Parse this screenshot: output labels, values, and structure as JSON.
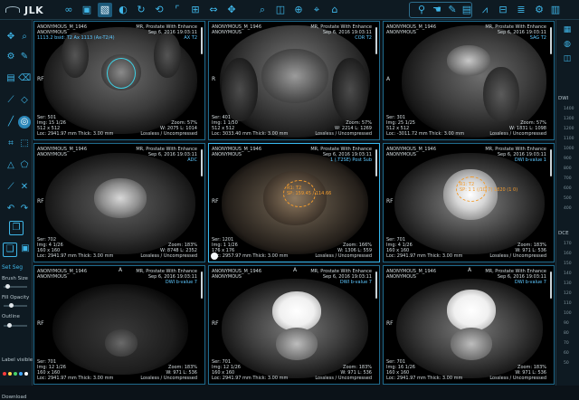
{
  "app": {
    "logo_text": "JLK"
  },
  "toolbar": {
    "tools": [
      {
        "name": "link-icon",
        "glyph": "∞"
      },
      {
        "name": "layout-icon",
        "glyph": "▣"
      },
      {
        "name": "image-icon",
        "glyph": "▧"
      },
      {
        "name": "window-level-icon",
        "glyph": "◐"
      },
      {
        "name": "rotate-icon",
        "glyph": "↻"
      },
      {
        "name": "reset-icon",
        "glyph": "⟲"
      },
      {
        "name": "fit-icon",
        "glyph": "⌜"
      },
      {
        "name": "split-icon",
        "glyph": "⊞"
      },
      {
        "name": "flip-icon",
        "glyph": "⇔"
      },
      {
        "name": "move-icon",
        "glyph": "✥"
      },
      {
        "name": "zoom-icon",
        "glyph": "⌕"
      },
      {
        "name": "measure-icon",
        "glyph": "◫"
      },
      {
        "name": "target-icon",
        "glyph": "⊕"
      },
      {
        "name": "crosshair-icon",
        "glyph": "⌖"
      },
      {
        "name": "tag-icon",
        "glyph": "⌂"
      },
      {
        "name": "pin-icon",
        "glyph": "⚲"
      },
      {
        "name": "hand-icon",
        "glyph": "☚"
      },
      {
        "name": "draw-icon",
        "glyph": "✎"
      },
      {
        "name": "note-icon",
        "glyph": "▤"
      },
      {
        "name": "chart-icon",
        "glyph": "⩘"
      },
      {
        "name": "grid-icon",
        "glyph": "⊟"
      },
      {
        "name": "list-icon",
        "glyph": "≣"
      },
      {
        "name": "settings-icon",
        "glyph": "⚙"
      },
      {
        "name": "report-icon",
        "glyph": "▥"
      }
    ]
  },
  "left_panel": {
    "set_seg": "Set Seg",
    "brush_size": "Brush Size",
    "fill_opacity": "Fill Opacity",
    "outline": "Outline",
    "label_visible": "Label visible",
    "download": "Download",
    "label_colors": [
      "#ff3b3b",
      "#ffd54a",
      "#49d36a",
      "#3fa7ff",
      "#ffffff"
    ],
    "fill_opacity_level": 0.3,
    "outline_level": 0.2,
    "brush_level": 0.1
  },
  "right_panel": {
    "dwi": "DWI",
    "dwi_values": [
      "1400",
      "1300",
      "1200",
      "1100",
      "1000",
      "900",
      "800",
      "700",
      "600",
      "500",
      "400"
    ],
    "dce": "DCE",
    "dce_values": [
      "170",
      "160",
      "150",
      "140",
      "130",
      "120",
      "110",
      "100",
      "90",
      "80",
      "70",
      "60",
      "50"
    ]
  },
  "viewports": [
    {
      "id": "ax-t2",
      "tl": [
        "ANONYMOUS_M_1946",
        "ANONYMOUS"
      ],
      "tl_accent": "1113.2  bsid: T2 Ax 1113 (Ax-T2/4)",
      "tr": [
        "MR, Prostate With Enhance",
        "Sep 6, 2016 19:03:11"
      ],
      "tr_accent": "AX T2",
      "bl": [
        "Ser: 501",
        "Img: 15 1/26",
        "512 x 512",
        "Loc: 2941.97 mm Thick: 3.00 mm"
      ],
      "br": [
        "Zoom: 57%",
        "W: 2075 L: 1014",
        "Lossless / Uncompressed"
      ],
      "orient_left": "RF"
    },
    {
      "id": "cor-t2",
      "tl": [
        "ANONYMOUS_M_1946",
        "ANONYMOUS"
      ],
      "tl_accent": "",
      "tr": [
        "MR, Prostate With Enhance",
        "Sep 6, 2016 19:03:11"
      ],
      "tr_accent": "COR T2",
      "bl": [
        "Ser: 401",
        "Img: 1 1/50",
        "512 x 512",
        "Loc: 3033.40 mm Thick: 3.00 mm"
      ],
      "br": [
        "Zoom: 57%",
        "W: 2214 L: 1269",
        "Lossless / Uncompressed"
      ],
      "orient_left": "R"
    },
    {
      "id": "sag-t2",
      "tl": [
        "ANONYMOUS_M_1946",
        "ANONYMOUS"
      ],
      "tl_accent": "",
      "tr": [
        "MR, Prostate With Enhance",
        "Sep 6, 2016 19:03:11"
      ],
      "tr_accent": "SAG T2",
      "bl": [
        "Ser: 301",
        "Img: 25 1/25",
        "512 x 512",
        "Loc: -3011.72 mm Thick: 3.00 mm"
      ],
      "br": [
        "Zoom: 57%",
        "W: 1831 L: 1098",
        "Lossless / Uncompressed"
      ],
      "orient_left": "A"
    },
    {
      "id": "adc",
      "tl": [
        "ANONYMOUS_M_1946",
        "ANONYMOUS"
      ],
      "tl_accent": "",
      "tr": [
        "MR, Prostate With Enhance",
        "Sep 6, 2016 19:03:11"
      ],
      "tr_accent": "ADC",
      "bl": [
        "Ser: 702",
        "Img: 4 1/26",
        "160 x 160",
        "Loc: 2941.97 mm Thick: 3.00 mm"
      ],
      "br": [
        "Zoom: 183%",
        "W: 8748 L: 2352",
        "Lossless / Uncompressed"
      ],
      "orient_left": "RF"
    },
    {
      "id": "t2-post",
      "tl": [
        "ANONYMOUS_M_1946",
        "ANONYMOUS"
      ],
      "tl_accent": "",
      "tr": [
        "MR, Prostate With Enhance",
        "Sep 6, 2016 19:03:11"
      ],
      "tr_accent": "1 (.T2SE) Post Sub",
      "bl": [
        "Ser: 1201",
        "Img: 1 1/26",
        "176 x 176",
        "Loc: 2957.97 mm Thick: 3.00 mm"
      ],
      "br": [
        "Zoom: 166%",
        "W: 1306 L: 559",
        "Lossless / Uncompressed"
      ],
      "orient_left": "RF",
      "roi": [
        "R1: T2",
        "SP: 159.45 / 114.66"
      ]
    },
    {
      "id": "dwi-1",
      "tl": [
        "ANONYMOUS_M_1946",
        "ANONYMOUS"
      ],
      "tl_accent": "",
      "tr": [
        "MR, Prostate With Enhance",
        "Sep 6, 2016 19:03:11"
      ],
      "tr_accent": "DWI b-value 1",
      "bl": [
        "Ser: 701",
        "Img: 4 1/26",
        "160 x 160",
        "Loc: 2941.97 mm Thick: 3.00 mm"
      ],
      "br": [
        "Zoom: 183%",
        "W: 971 L: 536",
        "Lossless / Uncompressed"
      ],
      "orient_left": "RF",
      "roi": [
        "R1: T2",
        "SP: 1 1 (/1D 7) 1820 (1 0)"
      ]
    },
    {
      "id": "dwi-7a",
      "tl": [
        "ANONYMOUS_M_1946",
        "ANONYMOUS"
      ],
      "tl_accent": "",
      "tr": [
        "MR, Prostate With Enhance",
        "Sep 6, 2016 19:03:11"
      ],
      "tr_accent": "DWI b-value 7",
      "bl": [
        "Ser: 701",
        "Img: 12 1/26",
        "160 x 160",
        "Loc: 2941.97 mm Thick: 3.00 mm"
      ],
      "br": [
        "Zoom: 183%",
        "W: 971 L: 536",
        "Lossless / Uncompressed"
      ],
      "orient_left": "RF",
      "orient_top": "A"
    },
    {
      "id": "dwi-7b",
      "tl": [
        "ANONYMOUS_M_1946",
        "ANONYMOUS"
      ],
      "tl_accent": "",
      "tr": [
        "MR, Prostate With Enhance",
        "Sep 6, 2016 19:03:11"
      ],
      "tr_accent": "DWI b-value 7",
      "bl": [
        "Ser: 701",
        "Img: 12 1/26",
        "160 x 160",
        "Loc: 2941.97 mm Thick: 3.00 mm"
      ],
      "br": [
        "Zoom: 183%",
        "W: 971 L: 536",
        "Lossless / Uncompressed"
      ],
      "orient_left": "RF",
      "orient_top": "A"
    },
    {
      "id": "dwi-7c",
      "tl": [
        "ANONYMOUS_M_1946",
        "ANONYMOUS"
      ],
      "tl_accent": "",
      "tr": [
        "MR, Prostate With Enhance",
        "Sep 6, 2016 19:03:11"
      ],
      "tr_accent": "DWI b-value 7",
      "bl": [
        "Ser: 701",
        "Img: 16 1/26",
        "160 x 160",
        "Loc: 2941.97 mm Thick: 3.00 mm"
      ],
      "br": [
        "Zoom: 183%",
        "W: 971 L: 536",
        "Lossless / Uncompressed"
      ],
      "orient_left": "RF",
      "orient_top": "A"
    }
  ]
}
